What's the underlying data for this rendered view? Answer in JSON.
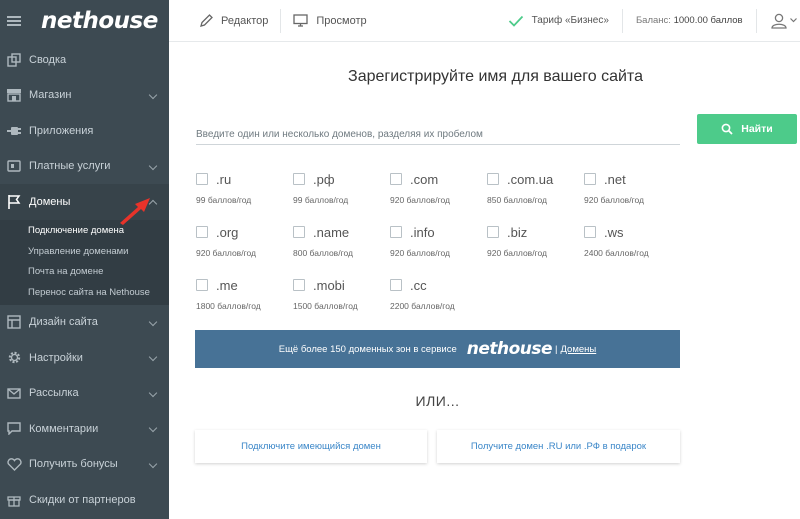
{
  "app": {
    "logo": "nethouse"
  },
  "sidebar": {
    "items": [
      {
        "label": "Сводка",
        "icon": "dashboard-icon",
        "chevron": false
      },
      {
        "label": "Магазин",
        "icon": "shop-icon",
        "chevron": true
      },
      {
        "label": "Приложения",
        "icon": "plugin-icon",
        "chevron": false
      },
      {
        "label": "Платные услуги",
        "icon": "wallet-icon",
        "chevron": true
      },
      {
        "label": "Домены",
        "icon": "flag-icon",
        "chevron": true,
        "expanded": true
      },
      {
        "label": "Дизайн сайта",
        "icon": "layout-icon",
        "chevron": true
      },
      {
        "label": "Настройки",
        "icon": "gear-icon",
        "chevron": true
      },
      {
        "label": "Рассылка",
        "icon": "mail-icon",
        "chevron": true
      },
      {
        "label": "Комментарии",
        "icon": "comment-icon",
        "chevron": true
      },
      {
        "label": "Получить бонусы",
        "icon": "heart-icon",
        "chevron": true
      },
      {
        "label": "Скидки от партнеров",
        "icon": "gift-icon",
        "chevron": false
      }
    ],
    "sub_items": [
      {
        "label": "Подключение домена"
      },
      {
        "label": "Управление доменами"
      },
      {
        "label": "Почта на домене"
      },
      {
        "label": "Перенос сайта на Nethouse"
      }
    ]
  },
  "header": {
    "editor": "Редактор",
    "preview": "Просмотр",
    "tariff": "Тариф «Бизнес»",
    "balance_label": "Баланс:",
    "balance_value": "1000.00 баллов"
  },
  "main": {
    "title": "Зарегистрируйте имя для вашего сайта",
    "search_placeholder": "Введите один или несколько доменов, разделяя их пробелом",
    "find_button": "Найти",
    "domains": [
      {
        "name": ".ru",
        "price": "99 баллов/год"
      },
      {
        "name": ".рф",
        "price": "99 баллов/год"
      },
      {
        "name": ".com",
        "price": "920 баллов/год"
      },
      {
        "name": ".com.ua",
        "price": "850 баллов/год"
      },
      {
        "name": ".net",
        "price": "920 баллов/год"
      },
      {
        "name": ".org",
        "price": "920 баллов/год"
      },
      {
        "name": ".name",
        "price": "800 баллов/год"
      },
      {
        "name": ".info",
        "price": "920 баллов/год"
      },
      {
        "name": ".biz",
        "price": "920 баллов/год"
      },
      {
        "name": ".ws",
        "price": "2400 баллов/год"
      },
      {
        "name": ".me",
        "price": "1800 баллов/год"
      },
      {
        "name": ".mobi",
        "price": "1500 баллов/год"
      },
      {
        "name": ".cc",
        "price": "2200 баллов/год"
      }
    ],
    "banner": {
      "text": "Ещё более 150 доменных зон в сервисе",
      "logo": "nethouse",
      "separator": "|",
      "link": "Домены"
    },
    "or_text": "ИЛИ...",
    "connect_existing": "Подключите имеющийся домен",
    "get_gift": "Получите домен .RU или .РФ в подарок"
  },
  "colors": {
    "sidebar": "#3d4a52",
    "accent_green": "#4dcb8a",
    "banner": "#477296",
    "link": "#3a86c8"
  }
}
